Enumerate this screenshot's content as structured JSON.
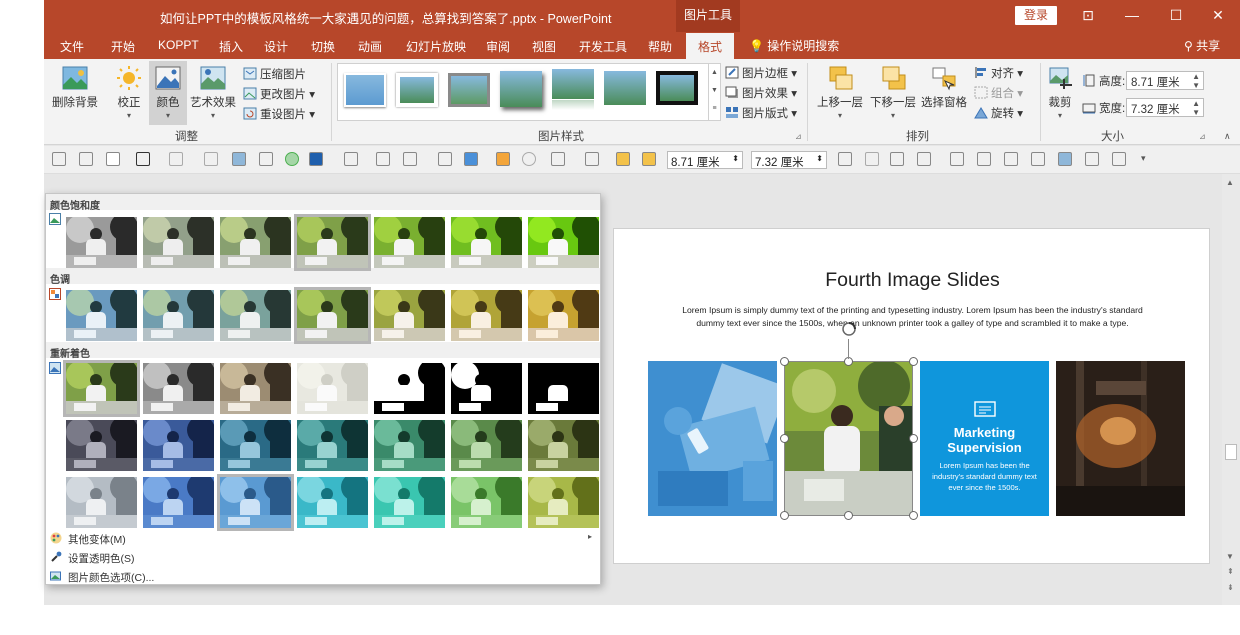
{
  "titlebar": {
    "title": "如何让PPT中的模板风格统一大家遇见的问题，总算找到答案了.pptx  -  PowerPoint",
    "context": "图片工具",
    "login": "登录",
    "btn_restore": "⊡",
    "btn_min": "—",
    "btn_max": "☐",
    "btn_close": "✕"
  },
  "tabs": [
    "文件",
    "开始",
    "KOPPT",
    "插入",
    "设计",
    "切换",
    "动画",
    "幻灯片放映",
    "审阅",
    "视图",
    "开发工具",
    "帮助",
    "格式"
  ],
  "tab_help": "操作说明搜索",
  "tab_share": "共享",
  "ribbon": {
    "remove_bg": "删除背景",
    "correct": "校正",
    "color": "颜色",
    "artistic": "艺术效果",
    "compress": "压缩图片",
    "change": "更改图片",
    "reset": "重设图片",
    "group_adjust": "调整",
    "border": "图片边框",
    "effects": "图片效果",
    "layout": "图片版式",
    "group_styles": "图片样式",
    "bring_forward": "上移一层",
    "send_backward": "下移一层",
    "selection_pane": "选择窗格",
    "align": "对齐",
    "group": "组合",
    "rotate": "旋转",
    "group_arrange": "排列",
    "crop": "裁剪",
    "height_label": "高度:",
    "height_value": "8.71 厘米",
    "width_label": "宽度:",
    "width_value": "7.32 厘米",
    "group_size": "大小"
  },
  "toolbar": {
    "height_value": "8.71 厘米",
    "width_value": "7.32 厘米"
  },
  "dropdown": {
    "sat_header": "颜色饱和度",
    "tone_header": "色调",
    "recolor_header": "重新着色",
    "more_variants": "其他变体(M)",
    "set_transparent": "设置透明色(S)",
    "color_options": "图片颜色选项(C)..."
  },
  "slide": {
    "title": "Fourth Image Slides",
    "body": "Lorem Ipsum is simply dummy text of the printing and typesetting industry. Lorem Ipsum has been the industry's standard dummy text ever since the 1500s, when an unknown printer took a galley of type and scrambled it to make a type.",
    "card_title": "Marketing Supervision",
    "card_text": "Lorem Ipsum has been the industry's standard dummy text ever since the 1500s."
  },
  "colors": {
    "accent": "#b7472a",
    "card_blue": "#0f96dc"
  }
}
